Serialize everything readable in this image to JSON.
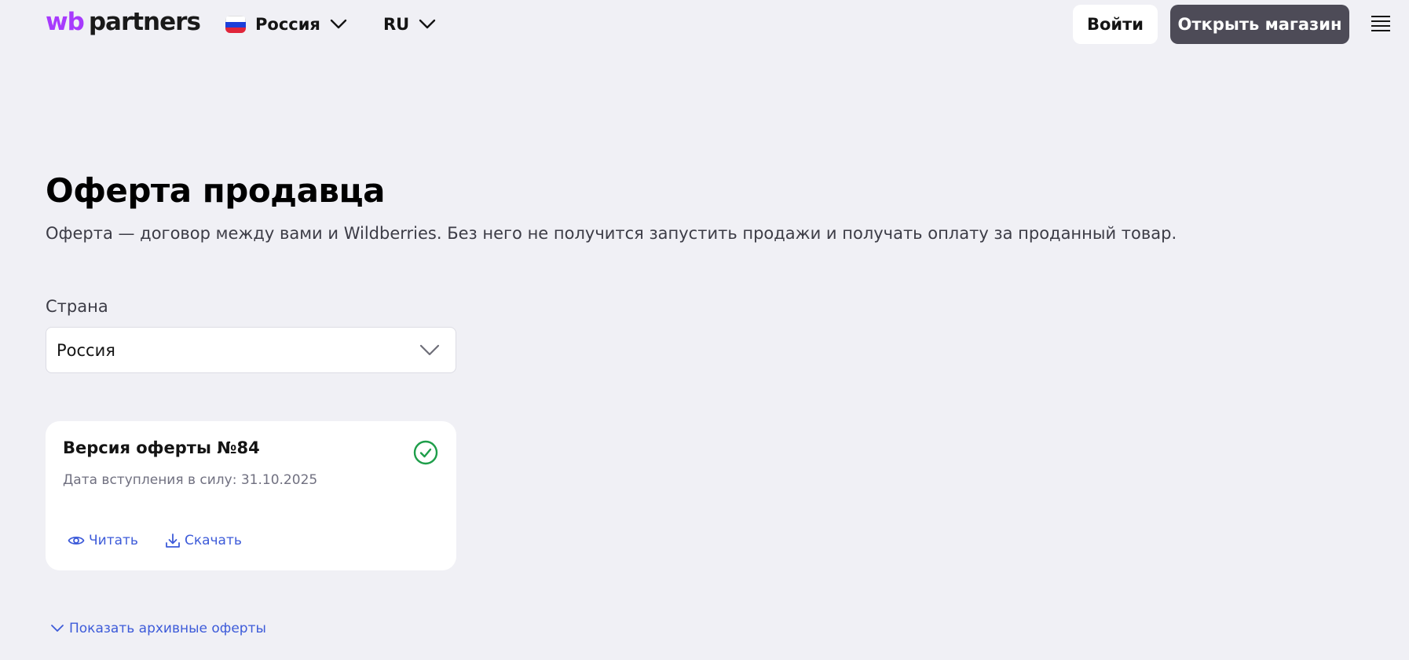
{
  "header": {
    "logo": {
      "part1": "wb",
      "part2": "partners"
    },
    "country": {
      "label": "Россия",
      "flag_icon": "russia-flag-icon"
    },
    "language": {
      "label": "RU"
    },
    "login_label": "Войти",
    "open_shop_label": "Открыть магазин",
    "menu_icon": "burger-menu-icon"
  },
  "main": {
    "title": "Оферта продавца",
    "subtitle": "Оферта — договор между вами и Wildberries. Без него не получится запустить продажи и получать оплату за проданный товар.",
    "country_field": {
      "label": "Страна",
      "value": "Россия"
    },
    "offer_card": {
      "title": "Версия оферты №84",
      "date": "Дата вступления в силу: 31.10.2025",
      "status_icon": "check-circle-icon",
      "read_label": "Читать",
      "download_label": "Скачать"
    },
    "archive_link_label": "Показать архивные оферты"
  },
  "colors": {
    "background": "#f0f0f5",
    "brand_purple": "#a73afd",
    "dark_button": "#4d4b57",
    "link_blue": "#3d5bd9",
    "success_green": "#1e9e4a"
  }
}
